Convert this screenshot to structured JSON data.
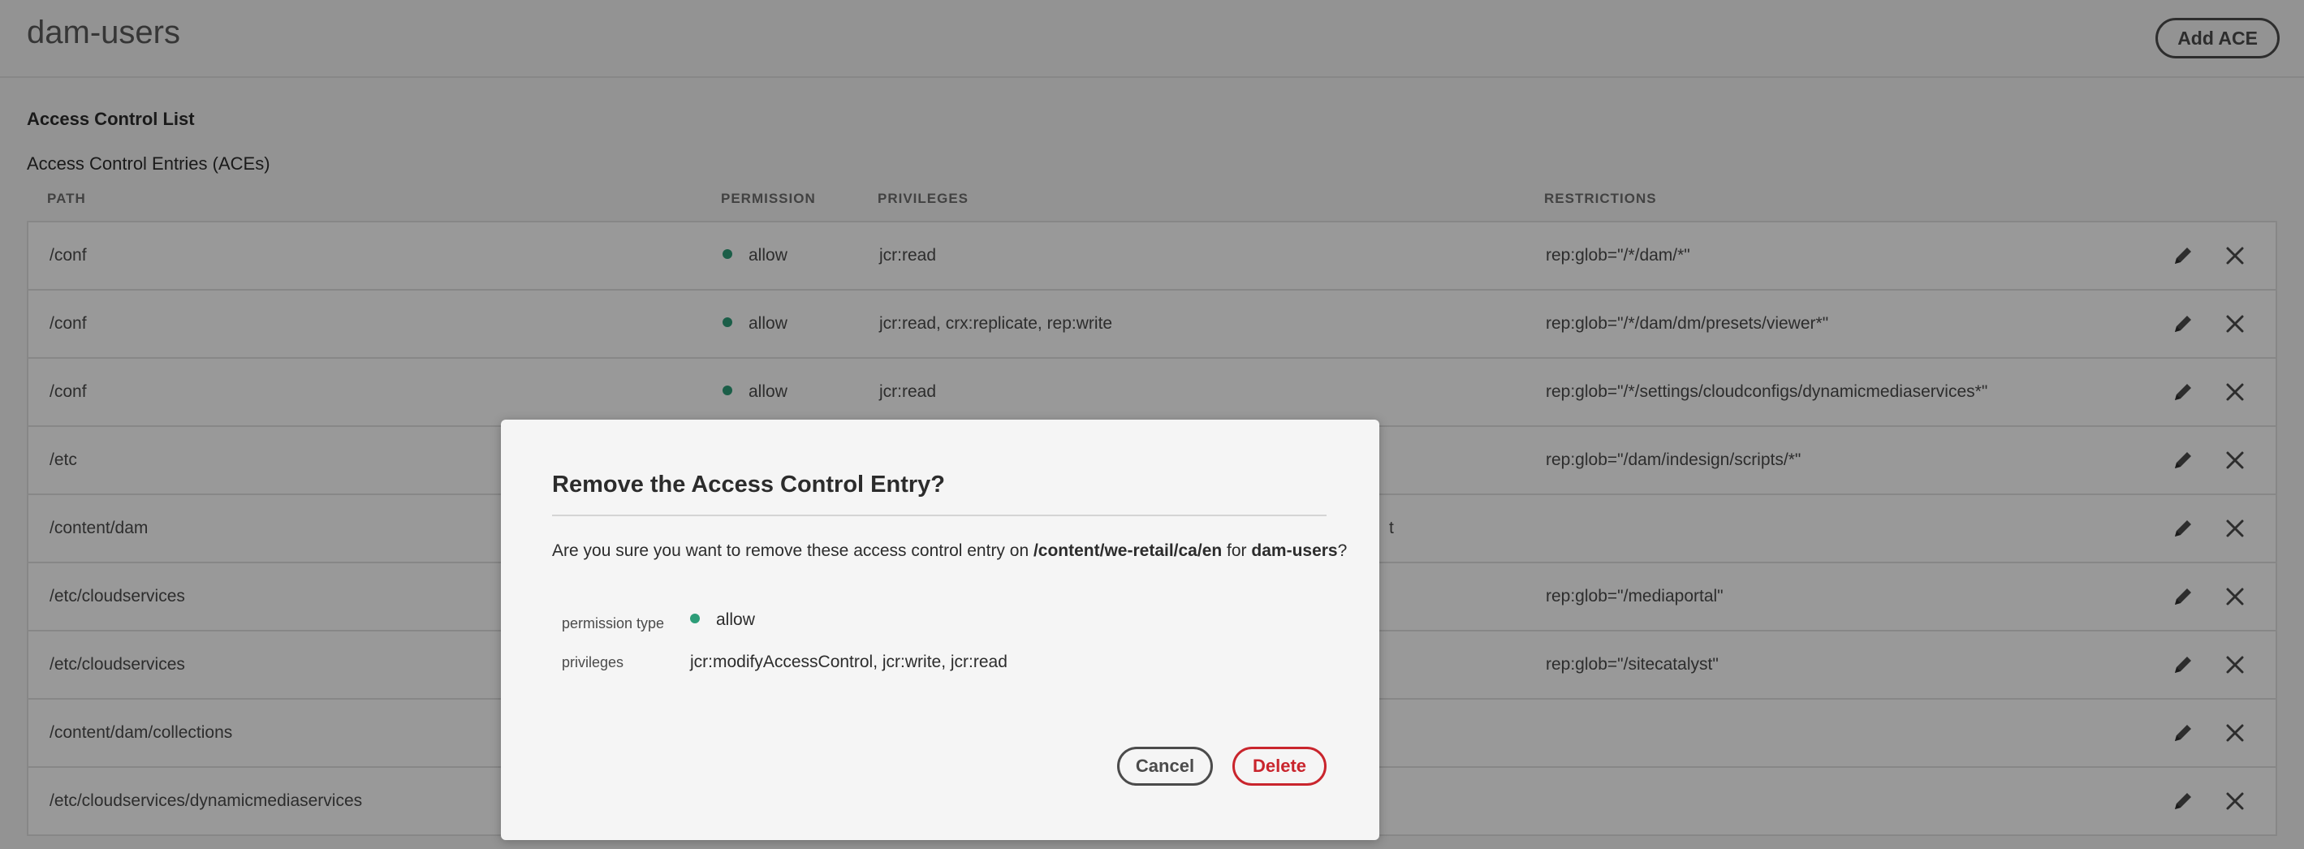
{
  "header": {
    "title": "dam-users",
    "add_ace_label": "Add ACE"
  },
  "acl": {
    "section_title": "Access Control List",
    "subtitle": "Access Control Entries (ACEs)",
    "columns": {
      "path": "PATH",
      "permission": "PERMISSION",
      "privileges": "PRIVILEGES",
      "restrictions": "RESTRICTIONS"
    },
    "rows": [
      {
        "path": "/conf",
        "permission": "allow",
        "privileges": "jcr:read",
        "restrictions": "rep:glob=\"/*/dam/*\""
      },
      {
        "path": "/conf",
        "permission": "allow",
        "privileges": "jcr:read, crx:replicate, rep:write",
        "restrictions": "rep:glob=\"/*/dam/dm/presets/viewer*\""
      },
      {
        "path": "/conf",
        "permission": "allow",
        "privileges": "jcr:read",
        "restrictions": "rep:glob=\"/*/settings/cloudconfigs/dynamicmediaservices*\""
      },
      {
        "path": "/etc",
        "permission": "",
        "privileges": "",
        "restrictions": "rep:glob=\"/dam/indesign/scripts/*\""
      },
      {
        "path": "/content/dam",
        "permission": "",
        "privileges": "",
        "restrictions": "t"
      },
      {
        "path": "/etc/cloudservices",
        "permission": "",
        "privileges": "",
        "restrictions": "rep:glob=\"/mediaportal\""
      },
      {
        "path": "/etc/cloudservices",
        "permission": "",
        "privileges": "",
        "restrictions": "rep:glob=\"/sitecatalyst\""
      },
      {
        "path": "/content/dam/collections",
        "permission": "",
        "privileges": "",
        "restrictions": ""
      },
      {
        "path": "/etc/cloudservices/dynamicmediaservices",
        "permission": "",
        "privileges": "",
        "restrictions": ""
      }
    ]
  },
  "dialog": {
    "title": "Remove the Access Control Entry?",
    "message_prefix": "Are you sure you want to remove these access control entry on ",
    "message_path": "/content/we-retail/ca/en",
    "message_for": " for ",
    "message_user": "dam-users",
    "message_suffix": "?",
    "permission_type_label": "permission type",
    "permission_type_value": "allow",
    "privileges_label": "privileges",
    "privileges_value": "jcr:modifyAccessControl, jcr:write, jcr:read",
    "cancel_label": "Cancel",
    "delete_label": "Delete"
  },
  "colors": {
    "allow_dot": "#2d9d78",
    "delete": "#c9252d",
    "overlay": "rgba(0,0,0,0.4)"
  },
  "icons": {
    "edit": "pencil-icon",
    "remove": "close-icon"
  }
}
